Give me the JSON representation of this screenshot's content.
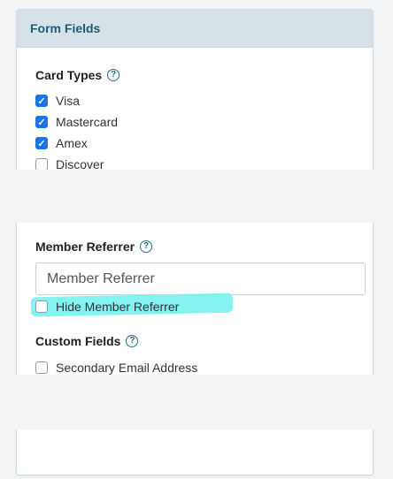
{
  "panel": {
    "title": "Form Fields"
  },
  "card_types": {
    "title": "Card Types",
    "help_icon": "question-circle-icon",
    "options": [
      {
        "label": "Visa",
        "checked": true
      },
      {
        "label": "Mastercard",
        "checked": true
      },
      {
        "label": "Amex",
        "checked": true
      },
      {
        "label": "Discover",
        "checked": false
      }
    ]
  },
  "member_referrer": {
    "title": "Member Referrer",
    "input_placeholder": "Member Referrer",
    "hide_label": "Hide Member Referrer",
    "hide_checked": false
  },
  "custom_fields": {
    "title": "Custom Fields",
    "options": [
      {
        "label": "Secondary Email Address",
        "checked": false
      }
    ]
  },
  "colors": {
    "header_bg": "#d6e2e8",
    "header_text": "#1f5b73",
    "checkbox_checked": "#1a73e8",
    "highlight": "#6ff0ee"
  }
}
